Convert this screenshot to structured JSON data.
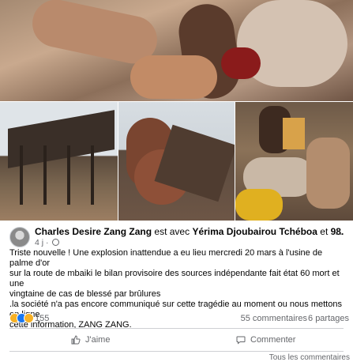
{
  "post": {
    "author": "Charles Desire Zang Zang",
    "with_text": "est avec",
    "tagged": "Yérima Djoubairou Tchéboa",
    "and_text": "et",
    "others": "98.",
    "time": "4 j",
    "more": "···",
    "text_lines": [
      "Triste nouvelle ! Une explosion inattendue a eu lieu mercredi 20 mars à l'usine de palme d'or",
      "sur la route de mbaiki le bilan provisoire des sources indépendante fait état 60 mort et une",
      "vingtaine de cas de blessé par brûlures",
      ".la société n'a pas encore communiqué sur cette tragédie au moment ou nous mettons en ligne",
      "cette information, ZANG ZANG."
    ]
  },
  "stats": {
    "reaction_count": "155",
    "comments": "55 commentaires",
    "shares": "6 partages",
    "reaction_icons": [
      "sad-icon",
      "like-icon",
      "wow-icon"
    ]
  },
  "actions": {
    "like_label": "J'aime",
    "comment_label": "Commenter"
  },
  "footer": {
    "all_comments": "Tous les commentaires"
  },
  "colors": {
    "like_blue": "#1877f2",
    "reaction_yellow": "#f7b125",
    "secondary_text": "#65676b",
    "divider": "#ced0d4"
  }
}
